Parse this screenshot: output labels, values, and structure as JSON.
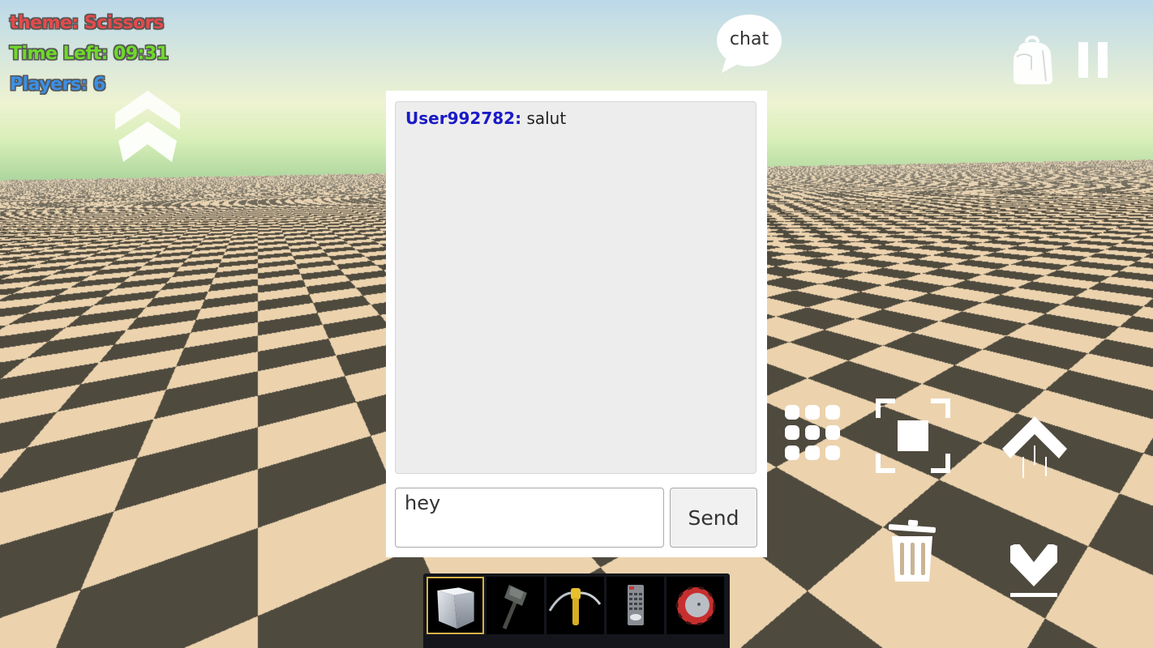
{
  "hud": {
    "theme": "theme: Scissors",
    "time_left": "Time Left: 09:31",
    "players": "Players: 6",
    "colors": {
      "theme": "#e44a4a",
      "time_left": "#6ed92a",
      "players": "#3b8fe6"
    }
  },
  "top_controls": {
    "chat_label": "chat",
    "icons": [
      "backpack-icon",
      "pause-icon",
      "jump-up-icon"
    ]
  },
  "chat": {
    "messages": [
      {
        "user": "User992782:",
        "text": "salut"
      }
    ],
    "input_value": "hey",
    "send_label": "Send"
  },
  "hotbar": {
    "selected_index": 0,
    "slots": [
      {
        "item": "cube-block"
      },
      {
        "item": "hammer"
      },
      {
        "item": "pickaxe"
      },
      {
        "item": "remote-control"
      },
      {
        "item": "spinning-disc"
      }
    ]
  },
  "right_controls": {
    "icons": [
      "grid-menu-icon",
      "camera-frame-icon",
      "fly-up-icon",
      "trash-icon",
      "drop-down-icon"
    ]
  },
  "scene": {
    "floor_light": "#ecd3ae",
    "floor_dark": "#4f4a3e",
    "sky_top": "#bcd9ea",
    "horizon": "#a6d39a"
  }
}
